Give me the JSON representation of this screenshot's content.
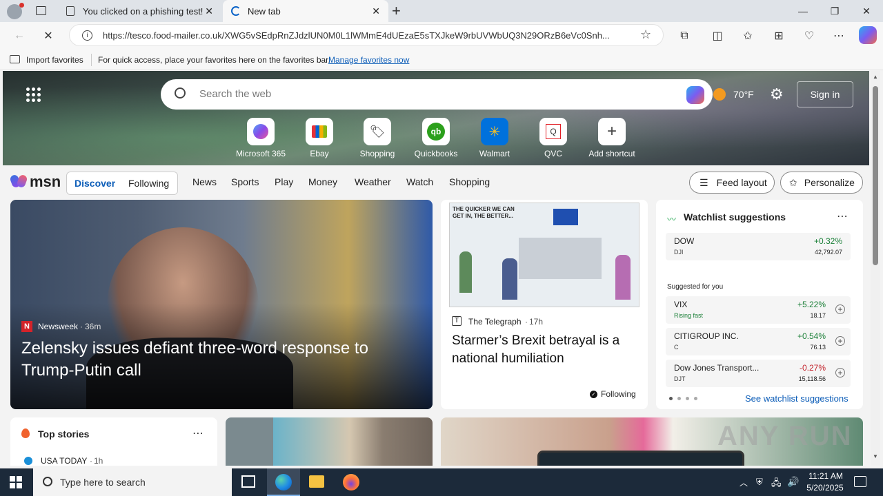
{
  "browser": {
    "tabs": [
      {
        "title": "You clicked on a phishing test!"
      },
      {
        "title": "New tab"
      }
    ],
    "url": "https://tesco.food-mailer.co.uk/XWG5vSEdpRnZJdzlUN0M0L1lWMmE4dUEzaE5sTXJkeW9rbUVWbUQ3N29ORzB6eVc0Snh...",
    "favbar": {
      "import_label": "Import favorites",
      "hint": "For quick access, place your favorites here on the favorites bar.",
      "manage_link": "Manage favorites now"
    }
  },
  "newtab": {
    "search_placeholder": "Search the web",
    "weather": "70°F",
    "sign_in": "Sign in",
    "shortcuts": [
      {
        "label": "Microsoft 365",
        "icon": "m365-icon"
      },
      {
        "label": "Ebay",
        "icon": "ebay-icon"
      },
      {
        "label": "Shopping",
        "icon": "shopping-tag-icon"
      },
      {
        "label": "Quickbooks",
        "icon": "quickbooks-icon"
      },
      {
        "label": "Walmart",
        "icon": "walmart-icon"
      },
      {
        "label": "QVC",
        "icon": "qvc-icon"
      },
      {
        "label": "Add shortcut",
        "icon": "plus-icon"
      }
    ],
    "msn": {
      "logo": "msn",
      "discover": "Discover",
      "following": "Following",
      "nav": [
        "News",
        "Sports",
        "Play",
        "Money",
        "Weather",
        "Watch",
        "Shopping"
      ],
      "feed_layout": "Feed layout",
      "personalize": "Personalize"
    },
    "hero_story": {
      "source": "Newsweek",
      "age": "36m",
      "headline": "Zelensky issues defiant three-word response to Trump-Putin call"
    },
    "second_story": {
      "cartoon_caption": "THE QUICKER WE CAN GET IN, THE BETTER...",
      "source": "The Telegraph",
      "age": "17h",
      "headline": "Starmer’s Brexit betrayal is a national humiliation",
      "following": "Following"
    },
    "watchlist": {
      "title": "Watchlist suggestions",
      "top": {
        "name": "DOW",
        "ticker": "DJI",
        "change": "+0.32%",
        "price": "42,792.07"
      },
      "suggested_label": "Suggested for you",
      "items": [
        {
          "name": "VIX",
          "sub": "Rising fast",
          "change": "+5.22%",
          "price": "18.17"
        },
        {
          "name": "CITIGROUP INC.",
          "sub": "C",
          "change": "+0.54%",
          "price": "76.13"
        },
        {
          "name": "Dow Jones Transport...",
          "sub": "DJT",
          "change": "-0.27%",
          "price": "15,118.56"
        }
      ],
      "see_link": "See watchlist suggestions"
    },
    "top_stories": {
      "title": "Top stories",
      "first_source": "USA TODAY",
      "first_age": "1h"
    }
  },
  "taskbar": {
    "search_placeholder": "Type here to search",
    "time": "11:21 AM",
    "date": "5/20/2025"
  },
  "watermark": "ANY RUN"
}
